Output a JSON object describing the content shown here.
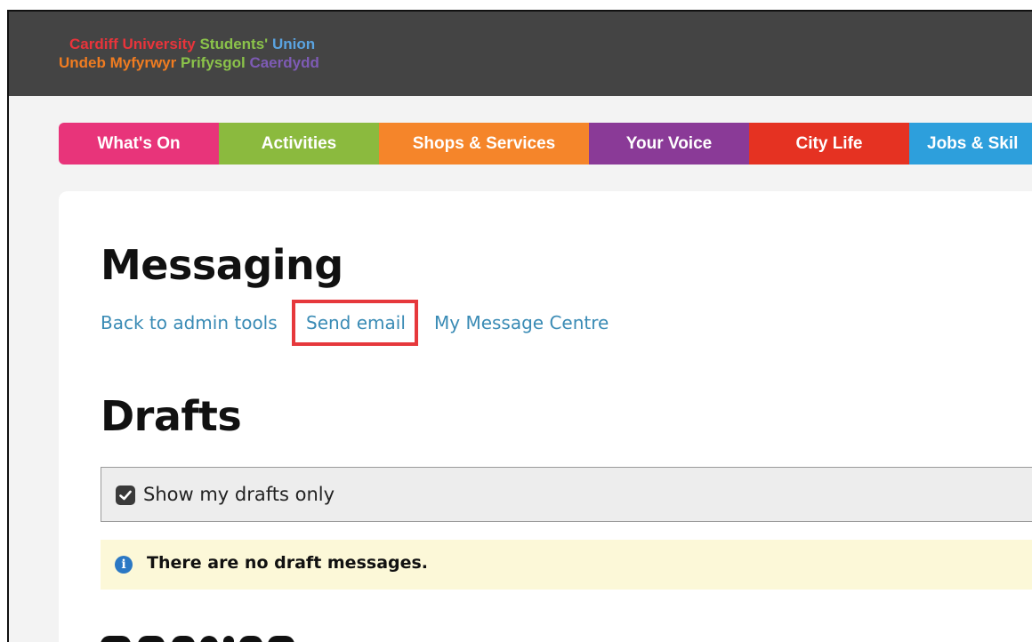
{
  "brand": {
    "line1": [
      {
        "text": "Cardiff University ",
        "color": "#e8343b"
      },
      {
        "text": "Students' ",
        "color": "#8bc34a"
      },
      {
        "text": "Union",
        "color": "#5aa3e0"
      }
    ],
    "line2": [
      {
        "text": "Undeb Myfyrwyr ",
        "color": "#f07c21"
      },
      {
        "text": "Prifysgol ",
        "color": "#8bc34a"
      },
      {
        "text": "Caerdydd",
        "color": "#7e5bb5"
      }
    ]
  },
  "nav": {
    "items": [
      {
        "label": "What's On",
        "color": "#e8347a"
      },
      {
        "label": "Activities",
        "color": "#8bba3e"
      },
      {
        "label": "Shops & Services",
        "color": "#f5852a"
      },
      {
        "label": "Your Voice",
        "color": "#8a3a97"
      },
      {
        "label": "City Life",
        "color": "#e53222"
      },
      {
        "label": "Jobs & Skil",
        "color": "#2d9fdc"
      }
    ]
  },
  "page": {
    "title": "Messaging",
    "links": {
      "back": "Back to admin tools",
      "send": "Send email",
      "centre": "My Message Centre"
    },
    "drafts_heading": "Drafts",
    "filter_label": "Show my drafts only",
    "notice": "There are no draft messages."
  },
  "colors": {
    "link": "#3a8bb5",
    "highlight": "#e6383c",
    "notice_bg": "#fcf8d8",
    "info_icon": "#2b78c4"
  }
}
